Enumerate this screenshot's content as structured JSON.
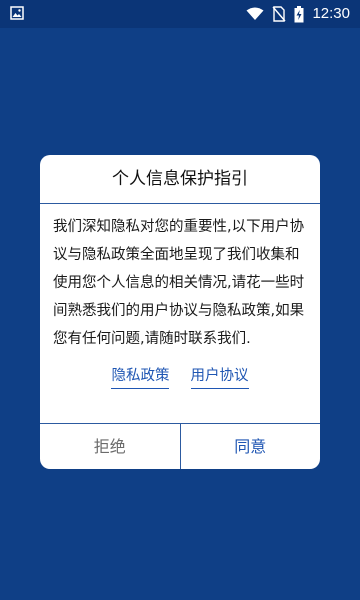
{
  "status_bar": {
    "time": "12:30",
    "icons": [
      "image-icon",
      "wifi-icon",
      "no-sim-icon",
      "battery-charging-icon"
    ]
  },
  "dialog": {
    "title": "个人信息保护指引",
    "body": "我们深知隐私对您的重要性,以下用户协议与隐私政策全面地呈现了我们收集和使用您个人信息的相关情况,请花一些时间熟悉我们的用户协议与隐私政策,如果您有任何问题,请随时联系我们.",
    "privacy_link": "隐私政策",
    "user_agreement_link": "用户协议",
    "reject_label": "拒绝",
    "agree_label": "同意"
  },
  "colors": {
    "background": "#0f3f86",
    "accent": "#1f56b3",
    "dialog_bg": "#ffffff"
  }
}
